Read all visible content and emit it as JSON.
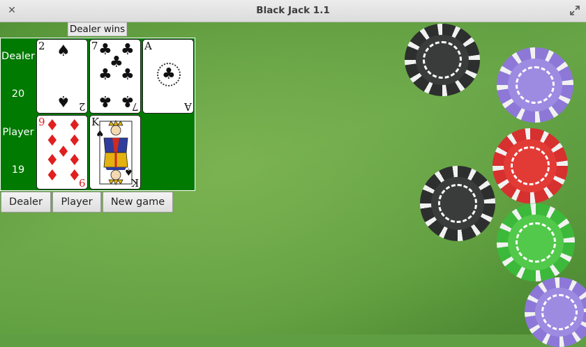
{
  "window": {
    "title": "Black Jack 1.1"
  },
  "game": {
    "result": "Dealer wins",
    "dealer": {
      "label": "Dealer",
      "score": "20",
      "cards": [
        {
          "rank": "2",
          "suit": "spades"
        },
        {
          "rank": "7",
          "suit": "clubs"
        },
        {
          "rank": "A",
          "suit": "clubs"
        }
      ]
    },
    "player": {
      "label": "Player",
      "score": "19",
      "cards": [
        {
          "rank": "9",
          "suit": "diamonds"
        },
        {
          "rank": "K",
          "suit": "spades"
        }
      ]
    }
  },
  "buttons": {
    "dealer": "Dealer",
    "player": "Player",
    "new_game": "New game"
  },
  "icons": {
    "close": "close-icon",
    "maximize": "maximize-icon"
  },
  "glyphs": {
    "spade": "♠",
    "club": "♣",
    "diamond": "♦",
    "close": "✕"
  },
  "colors": {
    "felt": "#5f9e43",
    "table": "#007a00",
    "red_suit": "#e0201f"
  }
}
